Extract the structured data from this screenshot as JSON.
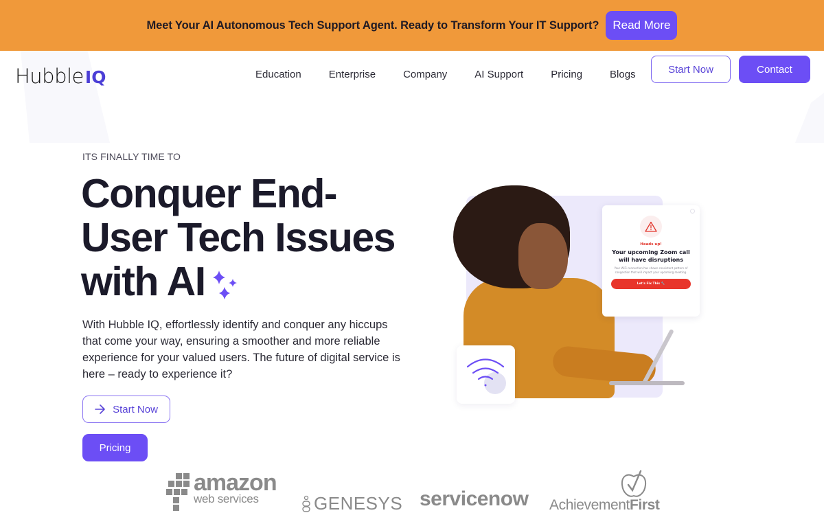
{
  "announcement": {
    "text": "Meet Your AI Autonomous Tech Support Agent. Ready to Transform Your IT Support?",
    "button_label": "Read More"
  },
  "header": {
    "logo_text": "Hubble",
    "logo_accent": "IQ",
    "nav": [
      {
        "label": "Education"
      },
      {
        "label": "Enterprise"
      },
      {
        "label": "Company"
      },
      {
        "label": "AI Support"
      },
      {
        "label": "Pricing"
      },
      {
        "label": "Blogs"
      }
    ],
    "start_now_label": "Start Now",
    "contact_label": "Contact"
  },
  "hero": {
    "eyebrow": "ITS FINALLY TIME TO",
    "headline": "Conquer End-User Tech Issues with AI",
    "description": "With Hubble IQ, effortlessly identify and conquer any hiccups that come your way, ensuring a smoother and more reliable experience for your valued users. The future of digital service is here – ready to experience it?",
    "start_now_label": "Start Now",
    "pricing_label": "Pricing",
    "alert_card": {
      "heads_up": "Heads up!",
      "title": "Your upcoming Zoom call will have disruptions",
      "body": "Your WiFi connection has shown consistent pattern of congestion that will impact your upcoming meeting.",
      "button_label": "Let's Fix This 🔧"
    }
  },
  "partners": [
    {
      "name": "amazon web services",
      "word": "amazon",
      "sub": "web services"
    },
    {
      "name": "GENESYS",
      "word": "GENESYS"
    },
    {
      "name": "servicenow",
      "word": "servicenow"
    },
    {
      "name": "Achievement First",
      "word": "Achievement",
      "bold": "First"
    }
  ],
  "colors": {
    "banner": "#f0993a",
    "brand": "#6c4ef5",
    "alert_red": "#e8352b"
  }
}
